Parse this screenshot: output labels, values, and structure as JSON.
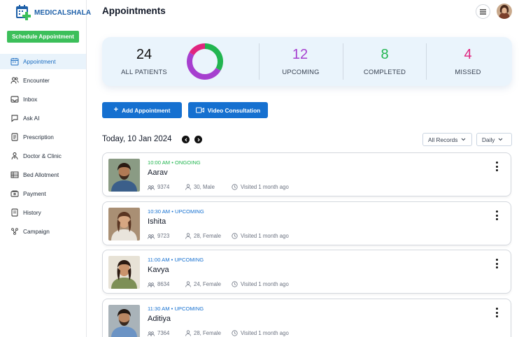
{
  "brand": {
    "name": "MEDICALSHALA",
    "primary_color": "#1d5fa8",
    "accent_green": "#3cbf5a"
  },
  "sidebar": {
    "schedule_label": "Schedule Appointment",
    "items": [
      {
        "label": "Appointment",
        "icon": "calendar-icon",
        "active": true
      },
      {
        "label": "Encounter",
        "icon": "users-icon"
      },
      {
        "label": "Inbox",
        "icon": "inbox-icon"
      },
      {
        "label": "Ask AI",
        "icon": "chat-icon"
      },
      {
        "label": "Prescription",
        "icon": "prescription-icon"
      },
      {
        "label": "Doctor & Clinic",
        "icon": "doctor-icon"
      },
      {
        "label": "Bed Allotment",
        "icon": "bed-icon"
      },
      {
        "label": "Payment",
        "icon": "payment-icon"
      },
      {
        "label": "History",
        "icon": "history-icon"
      },
      {
        "label": "Campaign",
        "icon": "campaign-icon"
      }
    ]
  },
  "header": {
    "title": "Appointments"
  },
  "stats": {
    "all_patients": {
      "value": "24",
      "label": "ALL PATIENTS"
    },
    "upcoming": {
      "value": "12",
      "label": "UPCOMING",
      "color": "#a63fcf"
    },
    "completed": {
      "value": "8",
      "label": "COMPLETED",
      "color": "#22b550"
    },
    "missed": {
      "value": "4",
      "label": "MISSED",
      "color": "#e0257f"
    }
  },
  "actions": {
    "add_label": "Add Appointment",
    "video_label": "Video Consultation"
  },
  "date_bar": {
    "date": "Today, 10 Jan 2024",
    "filter": "All Records",
    "period": "Daily"
  },
  "appointments": [
    {
      "time": "10:00 AM",
      "status": "ONGOING",
      "status_color": "#22b550",
      "name": "Aarav",
      "id": "9374",
      "age_gender": "30, Male",
      "visited": "Visited 1 month ago"
    },
    {
      "time": "10:30 AM",
      "status": "UPCOMING",
      "status_color": "#1570d0",
      "name": "Ishita",
      "id": "9723",
      "age_gender": "28, Female",
      "visited": "Visited 1 month ago"
    },
    {
      "time": "11:00 AM",
      "status": "UPCOMING",
      "status_color": "#1570d0",
      "name": "Kavya",
      "id": "8634",
      "age_gender": "24, Female",
      "visited": "Visited 1 month ago"
    },
    {
      "time": "11:30 AM",
      "status": "UPCOMING",
      "status_color": "#1570d0",
      "name": "Aditiya",
      "id": "7364",
      "age_gender": "28, Female",
      "visited": "Visited 1 month ago"
    }
  ]
}
